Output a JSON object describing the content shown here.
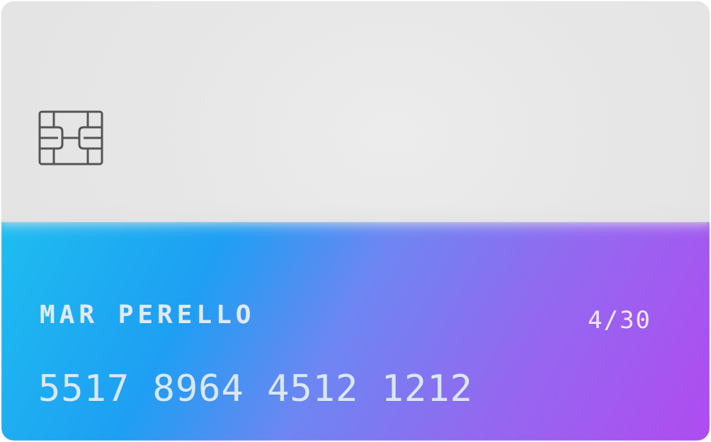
{
  "card": {
    "holder_name": "MAR PERELLO",
    "expiry": "4/30",
    "number": "5517 8964 4512 1212",
    "chip_icon": "card-chip-icon",
    "colors": {
      "top": "#e5e5e5",
      "gradient_start": "#1fbdf0",
      "gradient_mid": "#6d86f2",
      "gradient_end": "#b04cf0",
      "chip_stroke": "#555555"
    }
  }
}
